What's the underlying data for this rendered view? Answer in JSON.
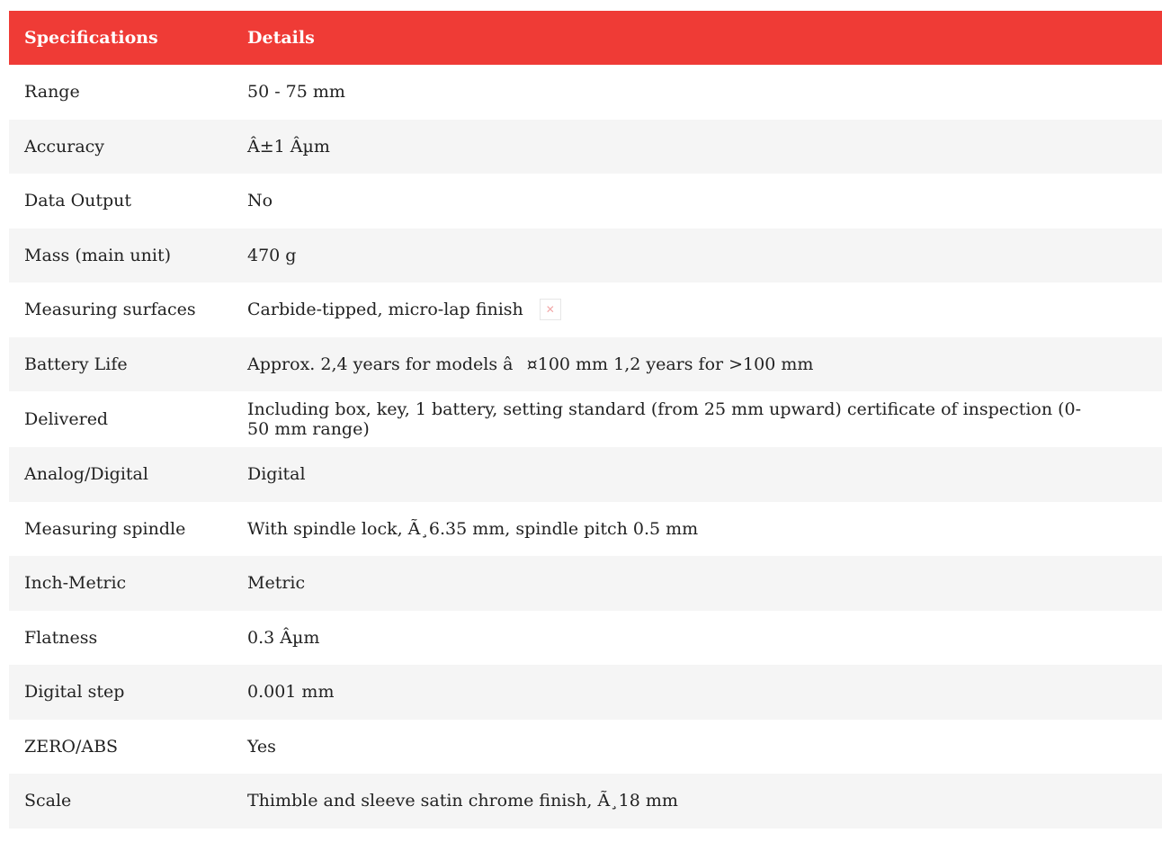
{
  "table": {
    "headers": [
      "Specifications",
      "Details"
    ],
    "header_bg": "#ef3b36",
    "header_text_color": "#ffffff",
    "rows": [
      {
        "spec": "Range",
        "detail": "50 - 75 mm"
      },
      {
        "spec": "Accuracy",
        "detail": "Â±1 Âµm"
      },
      {
        "spec": "Data Output",
        "detail": "No"
      },
      {
        "spec": "Mass (main unit)",
        "detail": "470 g"
      },
      {
        "spec": "Measuring surfaces",
        "detail": "Carbide-tipped, micro-lap finish",
        "icon": "broken-image-icon"
      },
      {
        "spec": "Battery Life",
        "detail": "Approx. 2,4 years for models â¤100 mm 1,2 years for >100 mm"
      },
      {
        "spec": "Delivered",
        "detail": "Including box, key, 1 battery, setting standard (from 25 mm upward) certificate of inspection (0-50 mm range)"
      },
      {
        "spec": "Analog/Digital",
        "detail": "Digital"
      },
      {
        "spec": "Measuring spindle",
        "detail": "With spindle lock, Ã¸6.35 mm, spindle pitch 0.5 mm"
      },
      {
        "spec": "Inch-Metric",
        "detail": "Metric"
      },
      {
        "spec": "Flatness",
        "detail": "0.3 Âµm"
      },
      {
        "spec": "Digital step",
        "detail": "0.001 mm"
      },
      {
        "spec": "ZERO/ABS",
        "detail": "Yes"
      },
      {
        "spec": "Scale",
        "detail": "Thimble and sleeve satin chrome finish, Ã¸18 mm"
      }
    ]
  }
}
